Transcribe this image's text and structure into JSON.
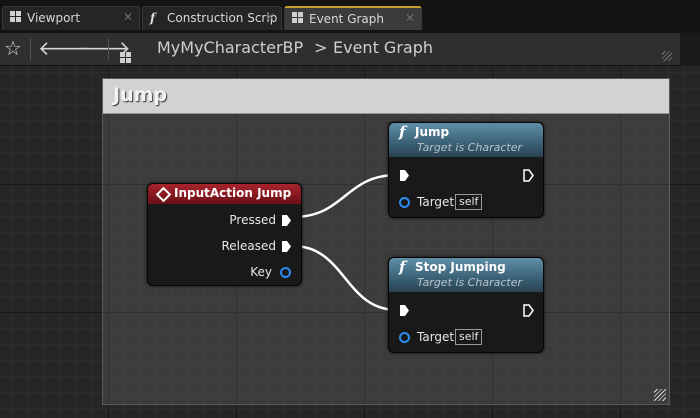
{
  "tabs": [
    {
      "label": "Viewport",
      "icon": "grid-icon",
      "active": false
    },
    {
      "label": "Construction Scrip",
      "icon": "function-icon",
      "active": false
    },
    {
      "label": "Event Graph",
      "icon": "grid-icon",
      "active": true
    }
  ],
  "toolbar": {
    "breadcrumb_blueprint": "MyMyCharacterBP",
    "breadcrumb_separator": ">",
    "breadcrumb_graph": "Event Graph"
  },
  "graph": {
    "comment_title": "Jump",
    "event_node": {
      "title": "InputAction Jump",
      "pins": {
        "pressed": "Pressed",
        "released": "Released",
        "key": "Key"
      }
    },
    "jump_node": {
      "title": "Jump",
      "subtitle": "Target is Character",
      "target_label": "Target",
      "target_value": "self"
    },
    "stop_node": {
      "title": "Stop Jumping",
      "subtitle": "Target is Character",
      "target_label": "Target",
      "target_value": "self"
    }
  },
  "colors": {
    "event_header": "#a8242c",
    "function_header": "#3a6075",
    "data_pin": "#2a8cf0",
    "active_tab_accent": "#c8a030"
  }
}
